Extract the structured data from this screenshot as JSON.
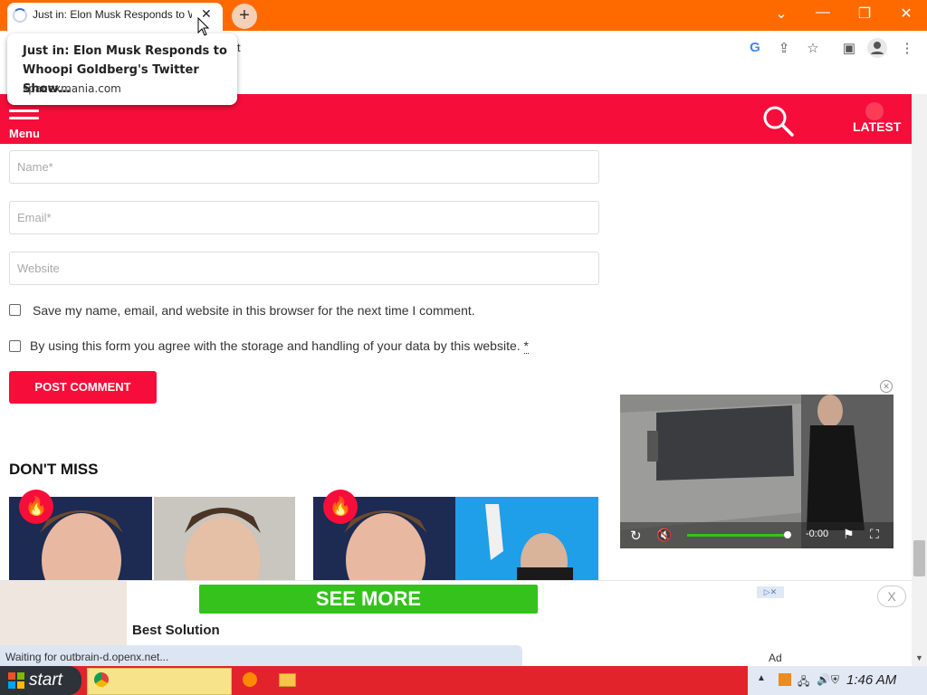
{
  "browser": {
    "tab_title": "Just in: Elon Musk Responds to Whoopi Goldberg's Twitter Show…",
    "tab_close": "✕",
    "new_tab": "+",
    "url_fragment": "t",
    "tooltip": {
      "title": "Just in: Elon Musk Responds to Whoopi Goldberg's Twitter Show…",
      "domain": "spacexmania.com"
    },
    "window_controls": [
      "⌄",
      "—",
      "❐",
      "✕"
    ],
    "toolbar_icons": [
      "google-icon",
      "share-icon",
      "star-icon",
      "side-panel-icon",
      "profile-icon",
      "more-icon"
    ],
    "status_text": "Waiting for outbrain-d.openx.net..."
  },
  "site": {
    "menu_label": "Menu",
    "latest_label": "LATEST"
  },
  "form": {
    "name_placeholder": "Name*",
    "email_placeholder": "Email*",
    "website_placeholder": "Website",
    "save_info_label": "Save my name, email, and website in this browser for the next time I comment.",
    "consent_label": "By using this form you agree with the storage and handling of your data by this website.",
    "consent_required": "*",
    "submit_label": "POST COMMENT"
  },
  "dont_miss": {
    "heading": "DON'T MISS",
    "badge_icon": "🔥"
  },
  "video_ad": {
    "time": "-0:00",
    "progress": 0.99
  },
  "bottom_ad": {
    "cta": "SEE MORE",
    "headline": "Best Solution",
    "close": "X",
    "ad_label": "Ad",
    "choice": "▷✕"
  },
  "taskbar": {
    "start_label": "start",
    "clock": "1:46 AM"
  },
  "colors": {
    "tabbar": "#fe6a00",
    "site_red": "#f70d3a",
    "cta_green": "#35c21c",
    "taskbar": "#e3232b"
  }
}
